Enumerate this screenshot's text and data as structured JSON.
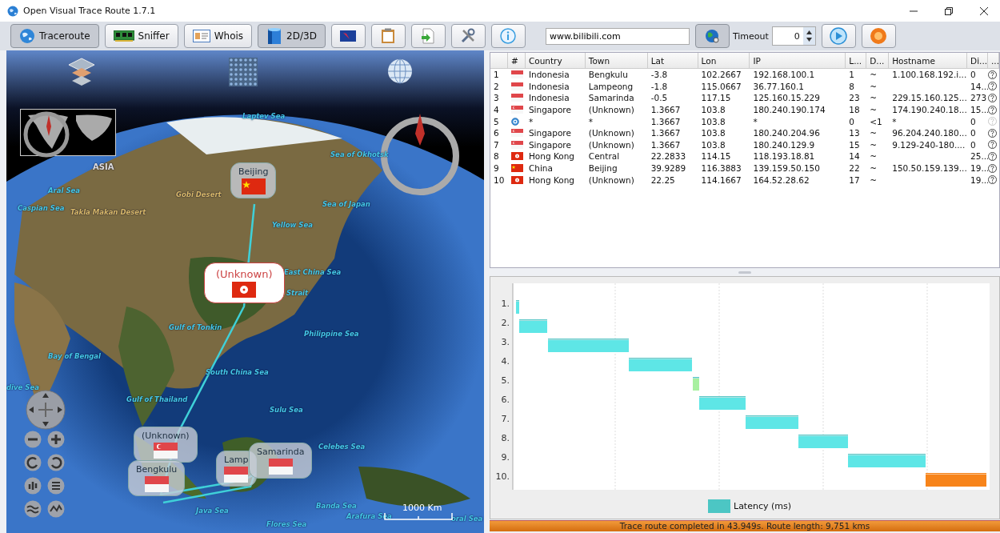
{
  "window": {
    "title": "Open Visual Trace Route 1.7.1"
  },
  "toolbar": {
    "tabs": [
      {
        "label": "Traceroute",
        "selected": true
      },
      {
        "label": "Sniffer",
        "selected": false
      },
      {
        "label": "Whois",
        "selected": false
      },
      {
        "label": "2D/3D",
        "selected": true
      }
    ],
    "host_field": {
      "value": "www.bilibili.com"
    },
    "timeout_label": "Timeout",
    "timeout_value": "0"
  },
  "map": {
    "labels": [
      "Laptev Sea",
      "Sea of Okhotsk",
      "ASIA",
      "Aral Sea",
      "Caspian Sea",
      "Gobi Desert",
      "Takla Makan Desert",
      "Sea of Japan",
      "Yellow Sea",
      "East China Sea",
      "Strait",
      "Gulf of Tonkin",
      "Philippine Sea",
      "Bay of Bengal",
      "South China Sea",
      "dive Sea",
      "Gulf of Thailand",
      "Sulu Sea",
      "Celebes Sea",
      "Java Sea",
      "Banda Sea",
      "Flores Sea",
      "Arafura Sea",
      "oral Sea"
    ],
    "markers": [
      {
        "label": "Beijing",
        "kind": "china",
        "selected": false
      },
      {
        "label": "(Unknown)",
        "kind": "hongkong",
        "selected": true
      },
      {
        "label": "(Unknown)",
        "kind": "singapore",
        "selected": false
      },
      {
        "label": "Bengkulu",
        "kind": "indonesia",
        "selected": false
      },
      {
        "label": "Lamp",
        "kind": "indonesia",
        "selected": false
      },
      {
        "label": "Samarinda",
        "kind": "indonesia",
        "selected": false
      }
    ],
    "scale": "1000 Km"
  },
  "table": {
    "columns": [
      "#",
      "Country",
      "Town",
      "Lat",
      "Lon",
      "IP",
      "L...",
      "D...",
      "Hostname",
      "Di...",
      "..."
    ],
    "rows": [
      {
        "kind": "indonesia",
        "disabled": false,
        "cells": [
          "1",
          "Indonesia",
          "Bengkulu",
          "-3.8",
          "102.2667",
          "192.168.100.1",
          "1",
          "~",
          "1.100.168.192.i...",
          "0"
        ]
      },
      {
        "kind": "indonesia",
        "disabled": false,
        "cells": [
          "2",
          "Indonesia",
          "Lampeong",
          "-1.8",
          "115.0667",
          "36.77.160.1",
          "8",
          "~",
          "",
          "14..."
        ]
      },
      {
        "kind": "indonesia",
        "disabled": false,
        "cells": [
          "3",
          "Indonesia",
          "Samarinda",
          "-0.5",
          "117.15",
          "125.160.15.229",
          "23",
          "~",
          "229.15.160.125...",
          "273"
        ]
      },
      {
        "kind": "singapore",
        "disabled": false,
        "cells": [
          "4",
          "Singapore",
          "(Unknown)",
          "1.3667",
          "103.8",
          "180.240.190.174",
          "18",
          "~",
          "174.190.240.18...",
          "15..."
        ]
      },
      {
        "kind": "unknown",
        "disabled": true,
        "cells": [
          "5",
          "*",
          "*",
          "1.3667",
          "103.8",
          "*",
          "0",
          "<1",
          "*",
          "0"
        ]
      },
      {
        "kind": "singapore",
        "disabled": false,
        "cells": [
          "6",
          "Singapore",
          "(Unknown)",
          "1.3667",
          "103.8",
          "180.240.204.96",
          "13",
          "~",
          "96.204.240.180...",
          "0"
        ]
      },
      {
        "kind": "singapore",
        "disabled": false,
        "cells": [
          "7",
          "Singapore",
          "(Unknown)",
          "1.3667",
          "103.8",
          "180.240.129.9",
          "15",
          "~",
          "9.129-240-180....",
          "0"
        ]
      },
      {
        "kind": "hongkong",
        "disabled": false,
        "cells": [
          "8",
          "Hong Kong",
          "Central",
          "22.2833",
          "114.15",
          "118.193.18.81",
          "14",
          "~",
          "",
          "25..."
        ]
      },
      {
        "kind": "china",
        "disabled": false,
        "cells": [
          "9",
          "China",
          "Beijing",
          "39.9289",
          "116.3883",
          "139.159.50.150",
          "22",
          "~",
          "150.50.159.139...",
          "19..."
        ]
      },
      {
        "kind": "hongkong",
        "disabled": false,
        "cells": [
          "10",
          "Hong Kong",
          "(Unknown)",
          "22.25",
          "114.1667",
          "164.52.28.62",
          "17",
          "~",
          "",
          "19..."
        ]
      }
    ]
  },
  "chart": {
    "row_labels": [
      "1.",
      "2.",
      "3.",
      "4.",
      "5.",
      "6.",
      "7.",
      "8.",
      "9.",
      "10."
    ],
    "legend": "Latency (ms)"
  },
  "status_bar": "Trace route completed in 43.949s. Route length: 9,751 kms"
}
